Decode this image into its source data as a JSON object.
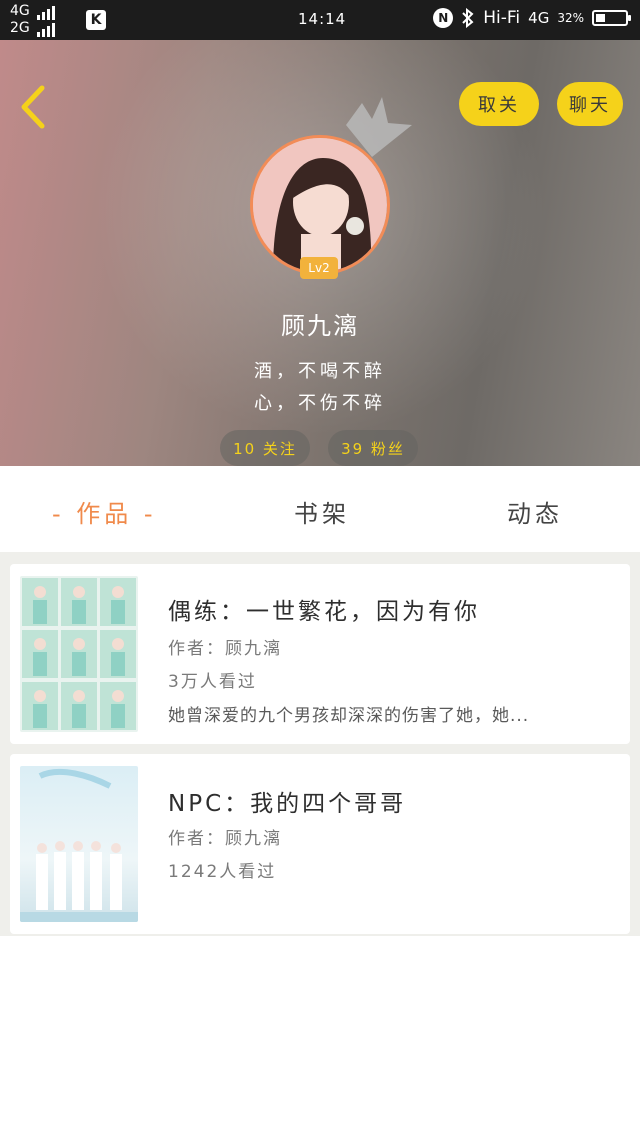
{
  "status_bar": {
    "net1": "4G",
    "net2": "2G",
    "time": "14:14",
    "nfc": "N",
    "hifi": "Hi-Fi",
    "net3": "4G",
    "battery": "32%"
  },
  "header": {
    "unfollow_label": "取关",
    "chat_label": "聊天",
    "level": "Lv2",
    "username": "顾九漓",
    "bio_line1": "酒，不喝不醉",
    "bio_line2": "心，不伤不碎",
    "following": "10 关注",
    "fans": "39 粉丝"
  },
  "tabs": [
    {
      "label": "- 作品 -",
      "active": true
    },
    {
      "label": "书架",
      "active": false
    },
    {
      "label": "动态",
      "active": false
    }
  ],
  "works": [
    {
      "title": "偶练：一世繁花，因为有你",
      "author": "作者：顾九漓",
      "views": "3万人看过",
      "description": "她曾深爱的九个男孩却深深的伤害了她，她..."
    },
    {
      "title": "NPC：我的四个哥哥",
      "author": "作者：顾九漓",
      "views": "1242人看过"
    }
  ],
  "colors": {
    "accent_yellow": "#f5d21a",
    "tab_active": "#f08a4b",
    "avatar_border": "#f28c57"
  }
}
